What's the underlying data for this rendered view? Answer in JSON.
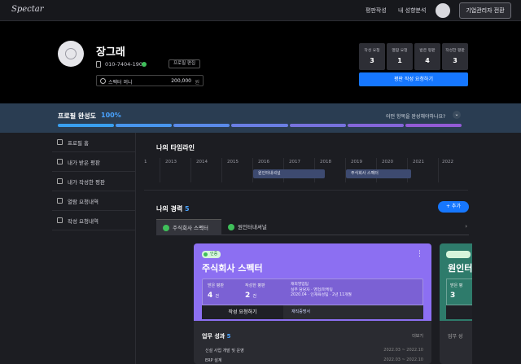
{
  "nav": {
    "logo": "Spectar",
    "links": [
      "평판작성",
      "내 성향분석"
    ],
    "company_button": "기업관리자 전환"
  },
  "profile": {
    "name": "장그래",
    "phone": "010-7404-1905",
    "edit_button": "프로필 편집",
    "money_label": "스펙터 머니",
    "money_value": "200,000",
    "money_arrow": "원",
    "stats": [
      {
        "label": "작성 요청",
        "value": "3"
      },
      {
        "label": "열람 요청",
        "value": "1"
      },
      {
        "label": "받은 평판",
        "value": "4"
      },
      {
        "label": "작성한 평판",
        "value": "3"
      }
    ],
    "request_button": "평판 작성 요청하기"
  },
  "completion": {
    "title": "프로필 완성도",
    "percent": "100%",
    "question": "어떤 항목을 완성해야하나요?",
    "segment_colors": [
      "#39a0f0",
      "#4896ee",
      "#5a8ae9",
      "#6a7ee3",
      "#7772dd",
      "#8466d9",
      "#925bd5"
    ]
  },
  "sidebar": {
    "items": [
      "프로필 홈",
      "내가 받은 평판",
      "내가 작성한 평판",
      "열람 요청내역",
      "작성 요청내역"
    ]
  },
  "timeline": {
    "title": "나의 타임라인",
    "start_marker": "1",
    "years": [
      "2013",
      "2014",
      "2015",
      "2016",
      "2017",
      "2018",
      "2019",
      "2020",
      "2021",
      "2022"
    ],
    "bars": [
      {
        "label": "원인터내셔널"
      },
      {
        "label": "주식회사 스펙터"
      }
    ]
  },
  "career": {
    "title": "나의 경력",
    "count": "5",
    "add_button": "+ 추가",
    "tabs": [
      "주식회사 스펙터",
      "원인터내셔널"
    ],
    "card": {
      "badge": "인증",
      "title": "주식회사 스펙터",
      "received_label": "받은 평판",
      "received_value": "4",
      "written_label": "작성한 평판",
      "written_value": "2",
      "unit": "건",
      "dept": "재외영업팀",
      "role": "실무 담당자 · 영업/마케팅",
      "period": "2020.04 · 인재육성팀 · 2년 11개월",
      "write_button": "작성 요청하기",
      "link_text": "재직증명서",
      "perf_title": "업무 성과",
      "perf_count": "5",
      "perf_more": "더보기",
      "perf_rows": [
        {
          "text": "신설 사업 개발 및 운영",
          "date": "2022.03 ~ 2022.10"
        },
        {
          "text": "ERP 설계",
          "date": "2022.03 ~ 2022.10"
        }
      ]
    },
    "card2": {
      "title": "원인터",
      "label": "받은 평",
      "value": "3",
      "perf": "업무 성"
    }
  }
}
